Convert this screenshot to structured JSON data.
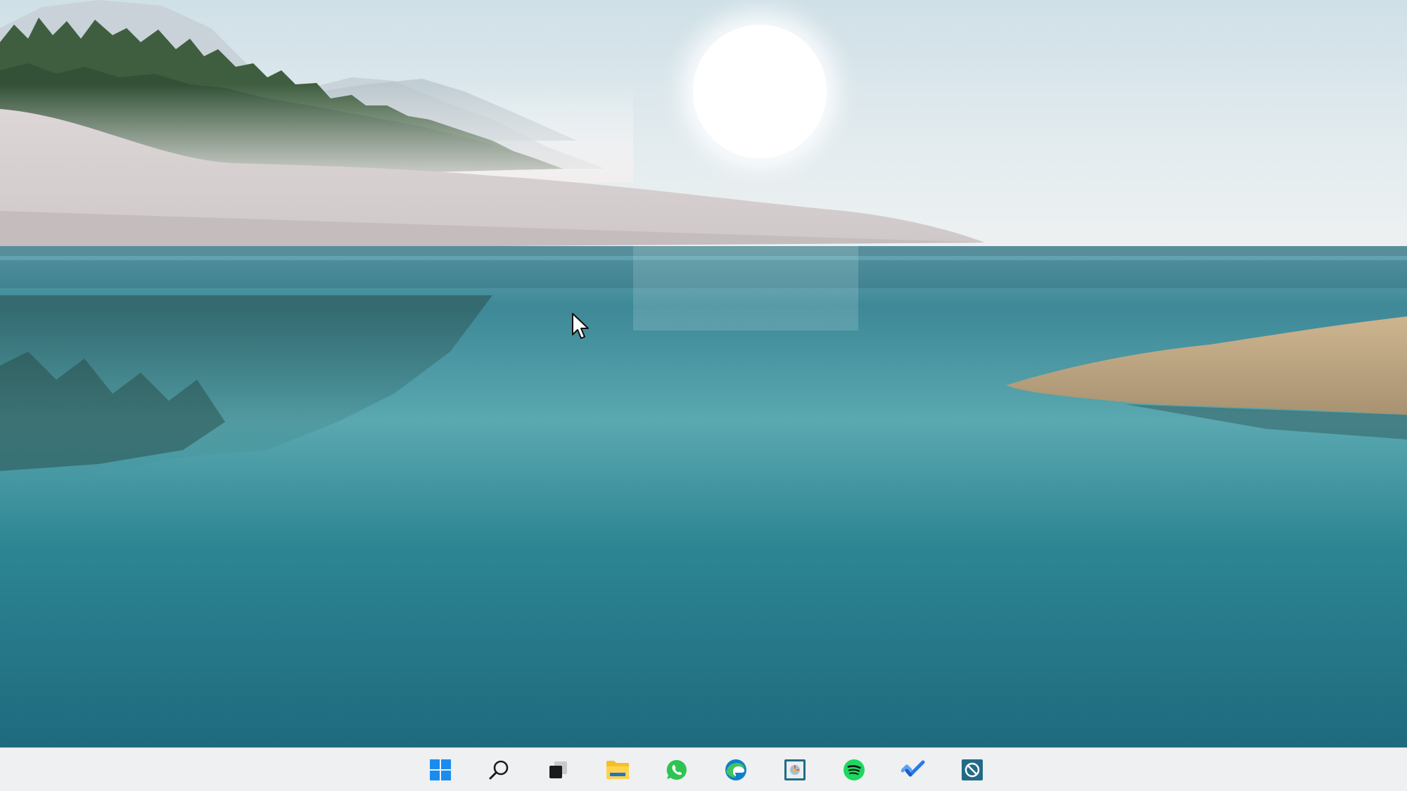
{
  "screen": {
    "type": "windows-11-desktop",
    "wallpaper": "lake-landscape"
  },
  "colors": {
    "taskbar_bg": "#eff0f2",
    "windows_blue": "#1a8cf0",
    "whatsapp_green": "#2fc353",
    "spotify_green": "#1ed760",
    "edge_blue": "#0f7fc9",
    "edge_green": "#43c55e",
    "folder_yellow": "#f5c025",
    "todo_blue": "#2a79e8",
    "app_box_teal": "#236a86"
  },
  "taskbar": {
    "items": [
      {
        "name": "start",
        "icon": "windows-logo-icon"
      },
      {
        "name": "search",
        "icon": "search-icon"
      },
      {
        "name": "task-view",
        "icon": "task-view-icon"
      },
      {
        "name": "file-explorer",
        "icon": "folder-icon"
      },
      {
        "name": "whatsapp",
        "icon": "whatsapp-icon"
      },
      {
        "name": "edge",
        "icon": "edge-icon"
      },
      {
        "name": "app-control-panel",
        "icon": "control-panel-icon"
      },
      {
        "name": "spotify",
        "icon": "spotify-icon"
      },
      {
        "name": "microsoft-todo",
        "icon": "checkmark-icon"
      },
      {
        "name": "app-blocker",
        "icon": "blocked-app-icon"
      }
    ]
  }
}
